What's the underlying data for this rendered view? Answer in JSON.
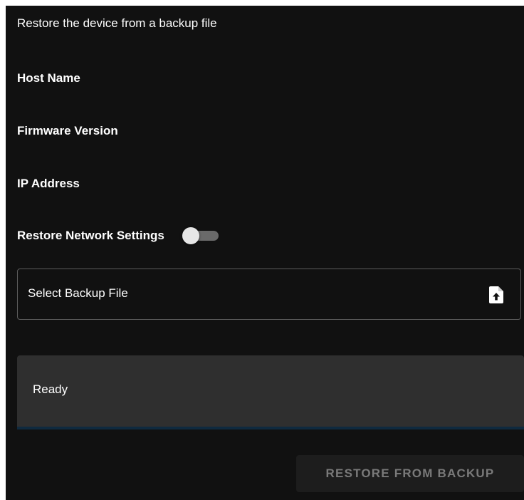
{
  "dialog": {
    "subtitle": "Restore the device from a backup file"
  },
  "fields": {
    "host_name_label": "Host Name",
    "firmware_version_label": "Firmware Version",
    "ip_address_label": "IP Address"
  },
  "restore_network": {
    "label": "Restore Network Settings",
    "enabled": false
  },
  "file_picker": {
    "label": "Select Backup File",
    "icon": "file-upload-icon"
  },
  "status": {
    "text": "Ready"
  },
  "actions": {
    "restore_label": "RESTORE FROM BACKUP",
    "restore_enabled": false
  },
  "colors": {
    "background": "#111111",
    "surface": "#2f2f2f",
    "text": "#ffffff",
    "disabled_text": "#7a7a7a",
    "field_border": "#5c5c5c"
  }
}
